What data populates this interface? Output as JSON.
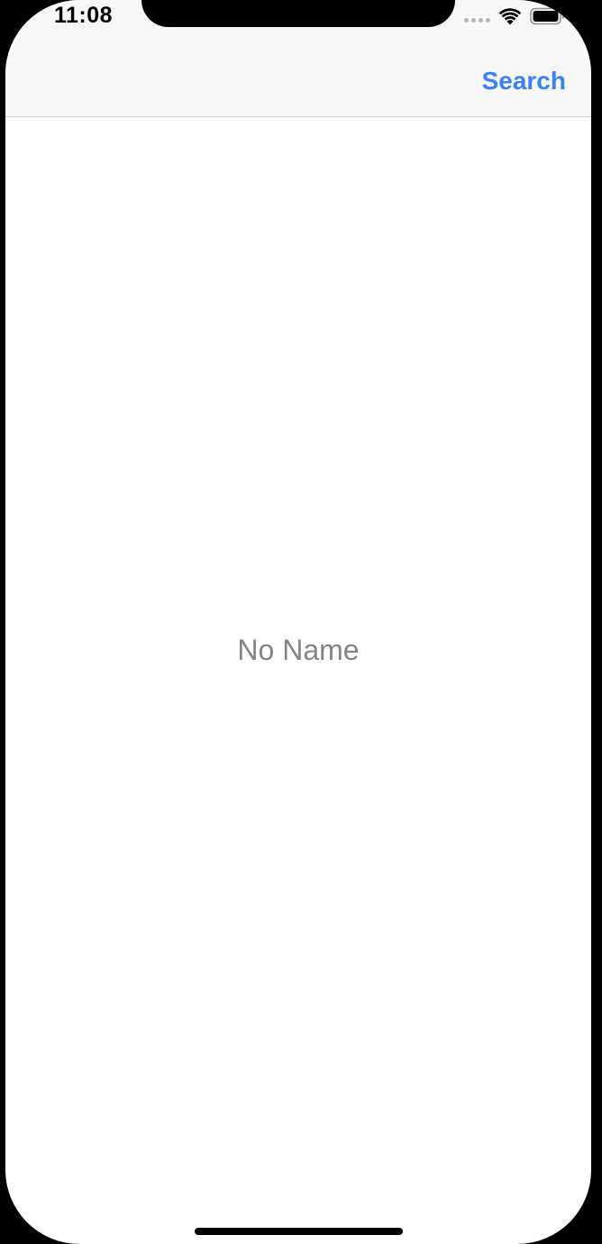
{
  "status_bar": {
    "time": "11:08",
    "icons": [
      "cellular-signal-icon",
      "wifi-icon",
      "battery-icon"
    ]
  },
  "nav_bar": {
    "right_button_label": "Search"
  },
  "content": {
    "empty_label": "No Name"
  },
  "colors": {
    "accent": "#3a82ef",
    "placeholder_text": "#858585",
    "nav_background": "#f7f7f7"
  }
}
